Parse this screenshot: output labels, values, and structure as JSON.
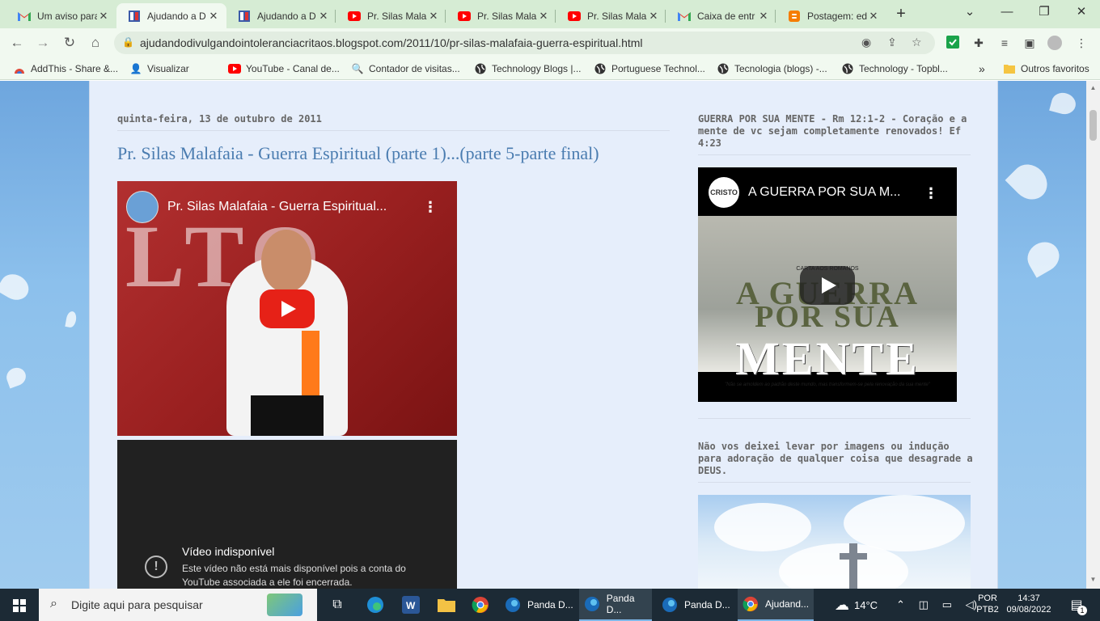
{
  "browser": {
    "tabs": [
      {
        "title": "Um aviso para",
        "icon": "gmail-icon"
      },
      {
        "title": "Ajudando a D",
        "icon": "blog-icon",
        "active": true
      },
      {
        "title": "Ajudando a D",
        "icon": "blog-icon"
      },
      {
        "title": "Pr. Silas Mala",
        "icon": "youtube-icon"
      },
      {
        "title": "Pr. Silas Mala",
        "icon": "youtube-icon"
      },
      {
        "title": "Pr. Silas Mala",
        "icon": "youtube-icon"
      },
      {
        "title": "Caixa de entr",
        "icon": "gmail-icon"
      },
      {
        "title": "Postagem: ed",
        "icon": "blogger-icon"
      }
    ],
    "url": "ajudandodivulgandointoleranciacritaos.blogspot.com/2011/10/pr-silas-malafaia-guerra-espiritual.html",
    "bookmarks": [
      {
        "label": "AddThis - Share &...",
        "icon": "addthis-icon"
      },
      {
        "label": "Visualizar",
        "icon": "visualizar-icon"
      },
      {
        "label": "YouTube - Canal de...",
        "icon": "youtube-icon"
      },
      {
        "label": "Contador de visitas...",
        "icon": "search-icon"
      },
      {
        "label": "Technology Blogs |...",
        "icon": "globe-icon"
      },
      {
        "label": "Portuguese Technol...",
        "icon": "globe-icon"
      },
      {
        "label": "Tecnologia (blogs) -...",
        "icon": "globe-icon"
      },
      {
        "label": "Technology - Topbl...",
        "icon": "globe-icon"
      }
    ],
    "bookmarks_more": "»",
    "other_bookmarks": "Outros favoritos"
  },
  "post": {
    "date": "quinta-feira, 13 de outubro de 2011",
    "title": "Pr. Silas Malafaia - Guerra Espiritual (parte 1)...(parte 5-parte final)",
    "video1_title": "Pr. Silas Malafaia - Guerra Espiritual...",
    "video2_title": "Vídeo indisponível",
    "video2_text": "Este vídeo não está mais disponível pois a conta do YouTube associada a ele foi encerrada."
  },
  "sidebar": {
    "widget1_title": "GUERRA POR SUA MENTE - Rm 12:1-2 - Coração e a mente de vc sejam completamente renovados! Ef 4:23",
    "video3_title": "A GUERRA POR SUA M...",
    "video3_channel_logo": "CRISTO",
    "video3_thumb": {
      "subtitle": "CARTA AOS ROMANOS",
      "line1": "A GUERRA",
      "line2": "POR SUA",
      "line3": "MENTE",
      "quote": "\"Não se amoldem ao padrão deste mundo, mas transformem-se pela renovação da sua mente\""
    },
    "widget2_title": "Não vos deixei levar por imagens ou indução para adoração de qualquer coisa que desagrade a DEUS."
  },
  "taskbar": {
    "search_placeholder": "Digite aqui para pesquisar",
    "apps": [
      {
        "label": "Panda D...",
        "icon": "panda-icon"
      },
      {
        "label": "Panda D...",
        "icon": "panda-icon"
      },
      {
        "label": "Panda D...",
        "icon": "panda-icon"
      },
      {
        "label": "Ajudand...",
        "icon": "chrome-icon"
      }
    ],
    "weather": "14°C",
    "language": "POR",
    "keyboard": "PTB2",
    "time": "14:37",
    "date": "09/08/2022",
    "notifications": "1"
  },
  "colors": {
    "accent": "#4a7cb0",
    "youtube_red": "#e62117",
    "tabstrip": "#d6ecd4"
  }
}
